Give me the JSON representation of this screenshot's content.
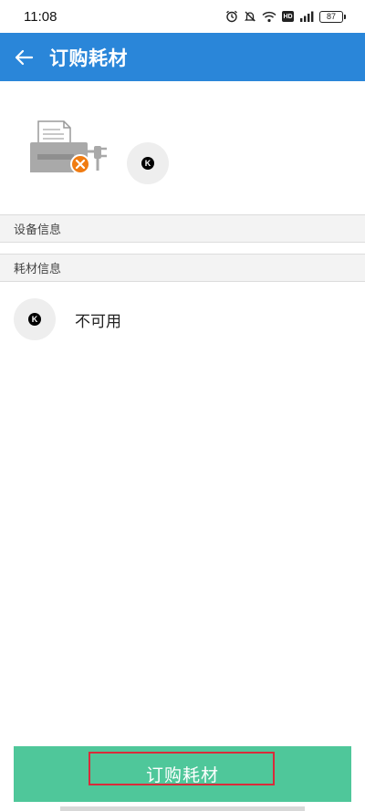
{
  "status_bar": {
    "time": "11:08",
    "battery": "87",
    "network_label": "HD"
  },
  "app_bar": {
    "title": "订购耗材",
    "back_icon": "arrow-left-icon"
  },
  "device": {
    "printer_icon": "printer-disconnected-icon",
    "cartridge_label": "K"
  },
  "sections": {
    "device_info": "设备信息",
    "supplies_info": "耗材信息"
  },
  "supply_item": {
    "cartridge_label": "K",
    "status": "不可用"
  },
  "order_button": {
    "label": "订购耗材"
  },
  "colors": {
    "app_bar": "#2a86d9",
    "order_button": "#4fc79a",
    "highlight_border": "#d92b3a",
    "error_badge": "#f07c12"
  }
}
